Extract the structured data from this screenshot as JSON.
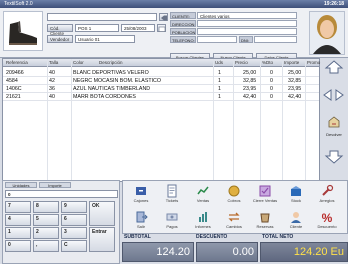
{
  "window": {
    "title": "TextilSoft 2.0",
    "time": "19:26:18"
  },
  "header": {
    "search_value": "",
    "code_label": "Cód. Cliente",
    "pos_value": "POS 1",
    "date_value": "25/08/2003",
    "vendor_label": "Vendedor",
    "vendor_value": "Usuario 01",
    "customer_fields": [
      {
        "label": "CLIENTE:",
        "value": "Clientes varios"
      },
      {
        "label": "DIRECCION:",
        "value": ""
      },
      {
        "label": "POBLACION:",
        "value": ""
      },
      {
        "label": "TELEFONO:",
        "value": ""
      }
    ],
    "dni_label": "DNI:",
    "dni_value": "",
    "customer_buttons": [
      "Buscar Clientes",
      "Nuevo Cliente",
      "Datos Cliente"
    ]
  },
  "grid": {
    "columns": [
      "Referencia",
      "Talla",
      "Color",
      "Descripción",
      "Uds",
      "Precio",
      "%Dto",
      "Importe",
      "Promo"
    ],
    "rows": [
      [
        "209466",
        "40",
        "",
        "BLANC DEPORTIVAS VELERO",
        "1",
        "25,00",
        "0",
        "25,00",
        ""
      ],
      [
        "4584",
        "42",
        "",
        "NEGRC MOCASIN BOM. ELASTICO",
        "1",
        "32,85",
        "0",
        "32,85",
        ""
      ],
      [
        "1406C",
        "36",
        "",
        "AZUL NAUTICAS TIMBERLAND",
        "1",
        "23,95",
        "0",
        "23,95",
        ""
      ],
      [
        "21621",
        "40",
        "",
        "MARR BOTA CORDONES",
        "1",
        "42,40",
        "0",
        "42,40",
        ""
      ]
    ]
  },
  "side": {
    "devolver_label": "Devolver"
  },
  "keypad": {
    "tabs": [
      "Unidades",
      "Importe"
    ],
    "display": "0",
    "keys": [
      "7",
      "8",
      "9",
      "4",
      "5",
      "6",
      "1",
      "2",
      "3",
      "0",
      ",",
      "C"
    ],
    "enter_label": "Entrar",
    "ok_label": "OK"
  },
  "actions": [
    {
      "label": "Cajones",
      "icon": "drawer-icon",
      "color": "#3a5ea8"
    },
    {
      "label": "Tickets",
      "icon": "receipt-icon",
      "color": "#6a7a9a"
    },
    {
      "label": "Ventas",
      "icon": "sales-icon",
      "color": "#2a8a4a"
    },
    {
      "label": "Cobros",
      "icon": "payment-icon",
      "color": "#c08a20"
    },
    {
      "label": "Cierre Ventas",
      "icon": "close-sales-icon",
      "color": "#8a4aa8"
    },
    {
      "label": "Stock",
      "icon": "stock-icon",
      "color": "#2a6ab8"
    },
    {
      "label": "Arreglos",
      "icon": "repairs-icon",
      "color": "#a83a3a"
    },
    {
      "label": "Salir",
      "icon": "exit-icon",
      "color": "#4a6a9a"
    },
    {
      "label": "Pagos",
      "icon": "payments-out-icon",
      "color": "#7a8aaa"
    },
    {
      "label": "Informes",
      "icon": "reports-icon",
      "color": "#3a8a8a"
    },
    {
      "label": "Cambios",
      "icon": "exchanges-icon",
      "color": "#b86a2a"
    },
    {
      "label": "Reservas",
      "icon": "reservations-icon",
      "color": "#6a4a2a"
    },
    {
      "label": "Cliente",
      "icon": "customer-icon",
      "color": "#3a6aa8"
    },
    {
      "label": "Descuento",
      "icon": "discount-icon",
      "color": "#b82a2a"
    }
  ],
  "totals": {
    "subtotal_label": "SUBTOTAL",
    "subtotal_value": "124.20",
    "discount_label": "DESCUENTO",
    "discount_value": "0.00",
    "net_label": "TOTAL NETO",
    "net_value": "124.20 Eu"
  }
}
